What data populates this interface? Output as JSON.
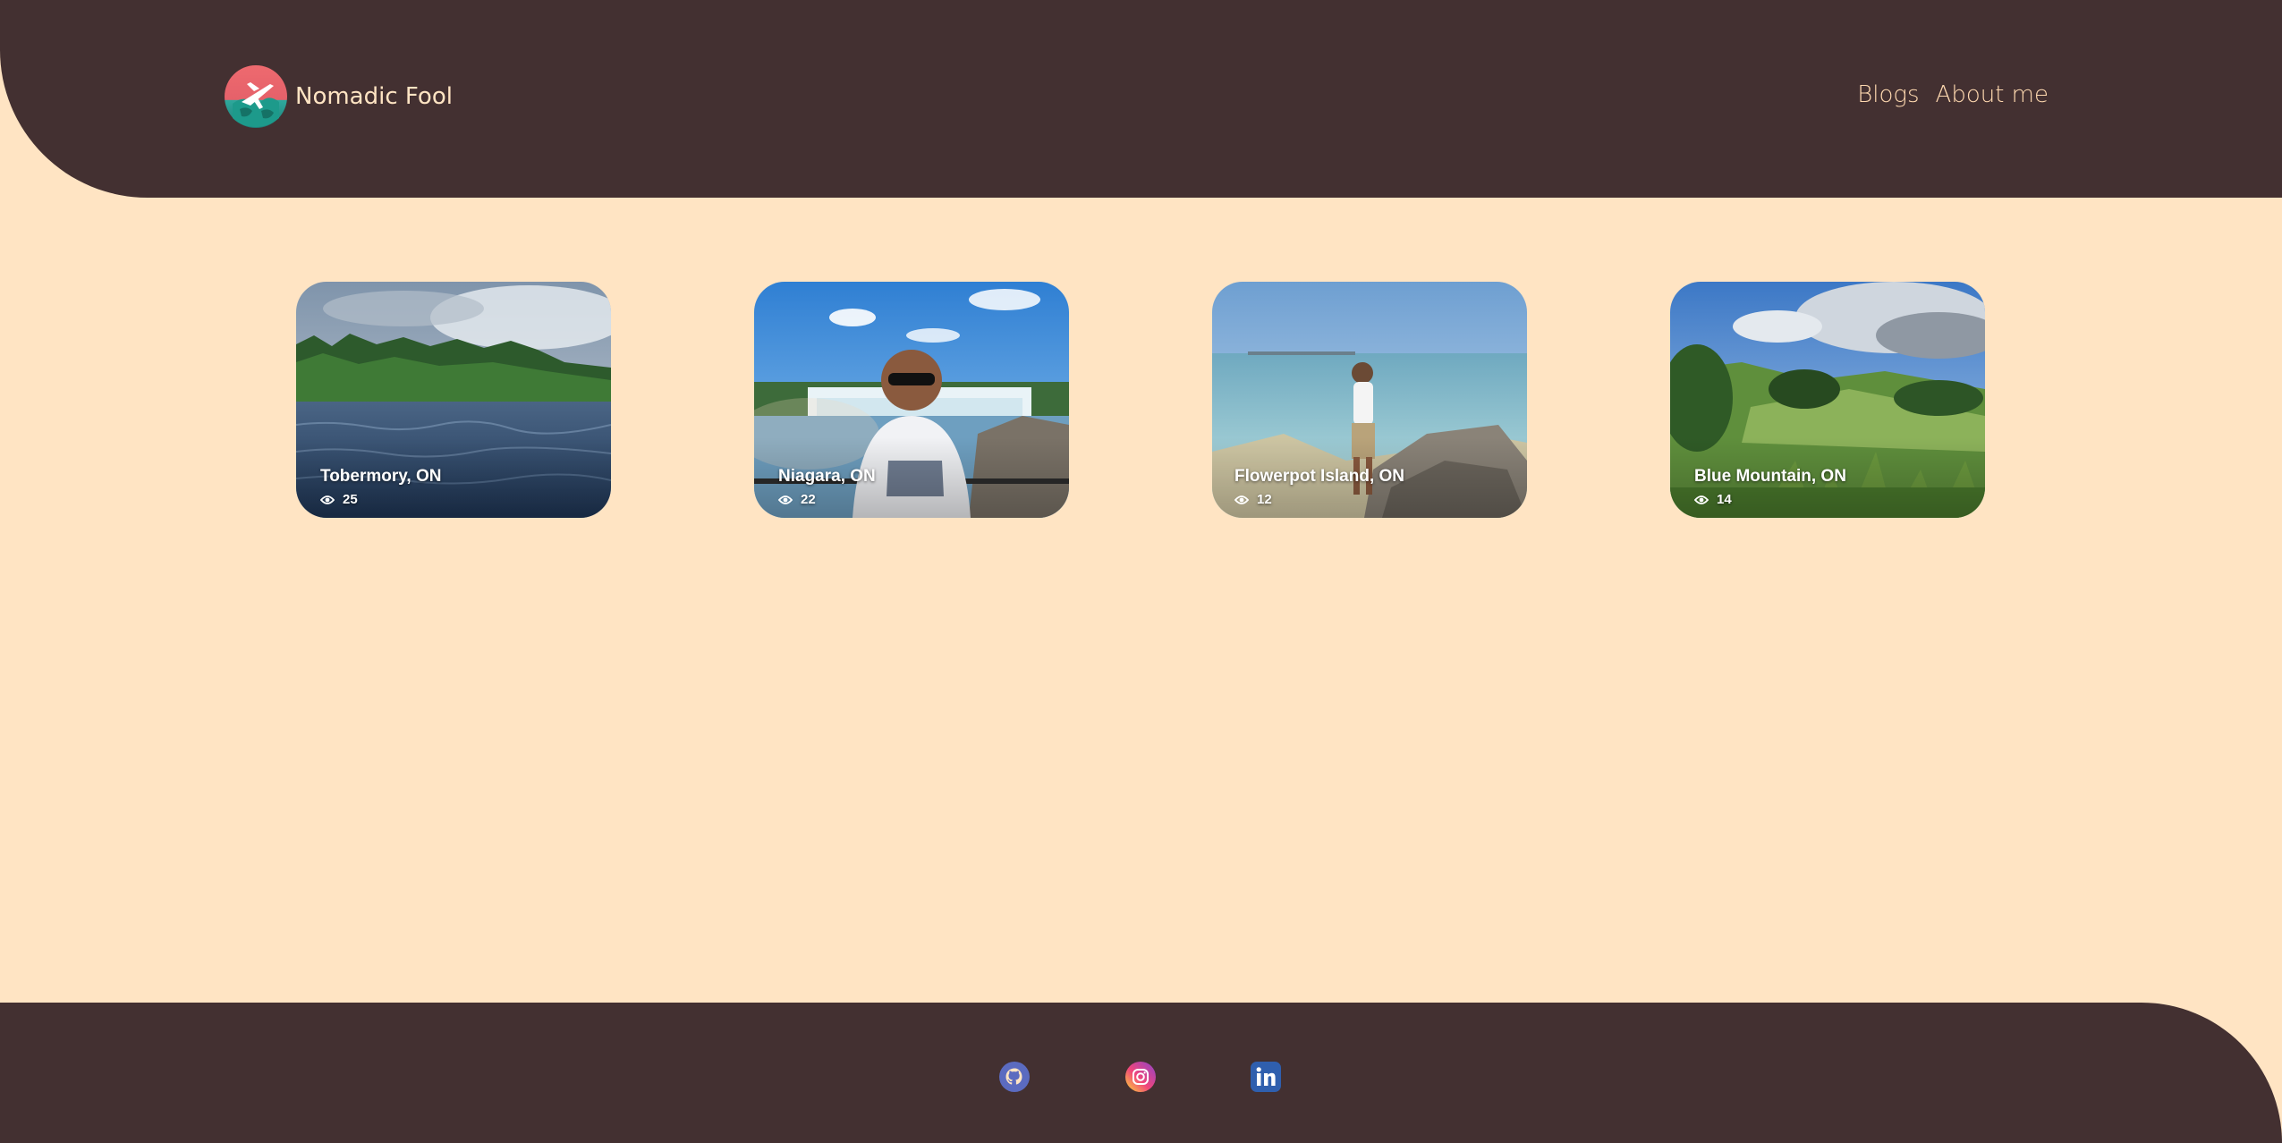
{
  "header": {
    "brand_name": "Nomadic Fool",
    "logo_icon": "globe-airplane-logo-icon",
    "nav": {
      "blogs_label": "Blogs",
      "about_label": "About me"
    }
  },
  "cards": [
    {
      "title": "Tobermory, ON",
      "views": "25",
      "icon": "eye-icon"
    },
    {
      "title": "Niagara, ON",
      "views": "22",
      "icon": "eye-icon"
    },
    {
      "title": "Flowerpot Island, ON",
      "views": "12",
      "icon": "eye-icon"
    },
    {
      "title": "Blue Mountain, ON",
      "views": "14",
      "icon": "eye-icon"
    }
  ],
  "footer": {
    "social": [
      {
        "icon": "github-icon"
      },
      {
        "icon": "instagram-icon"
      },
      {
        "icon": "linkedin-icon"
      }
    ]
  },
  "colors": {
    "background": "#ffe4c3",
    "header_footer": "#433031",
    "header_text": "#ffe4c3",
    "nav_text": "#ffd9b0",
    "github": "#5b6bc0",
    "linkedin": "#2f5fae"
  }
}
